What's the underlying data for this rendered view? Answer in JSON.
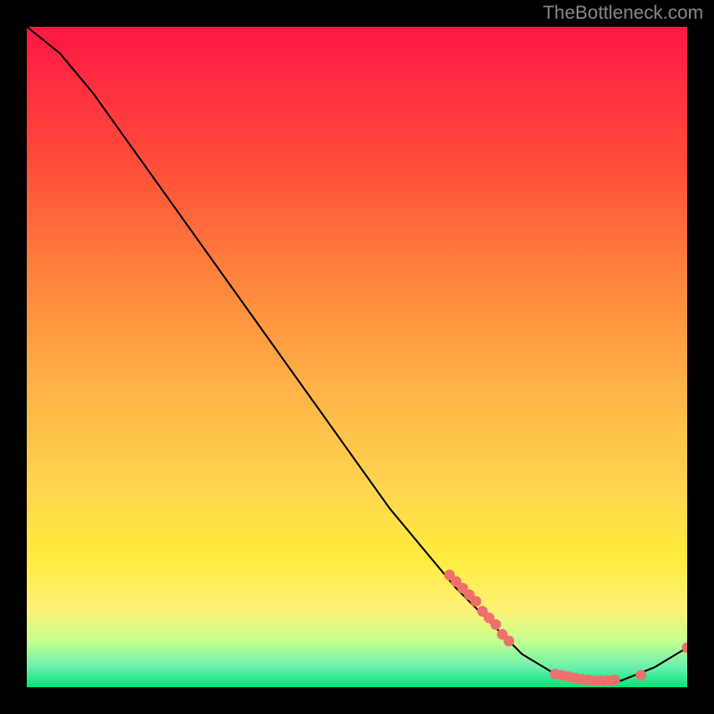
{
  "attribution": "TheBottleneck.com",
  "chart_data": {
    "type": "line",
    "title": "",
    "xlabel": "",
    "ylabel": "",
    "xlim": [
      0,
      100
    ],
    "ylim": [
      0,
      100
    ],
    "gradient_stops": [
      {
        "offset": 0,
        "color": "#ff1744"
      },
      {
        "offset": 20,
        "color": "#ff4b3a"
      },
      {
        "offset": 40,
        "color": "#ff8a3d"
      },
      {
        "offset": 55,
        "color": "#ffb347"
      },
      {
        "offset": 70,
        "color": "#ffd54f"
      },
      {
        "offset": 80,
        "color": "#ffeb3b"
      },
      {
        "offset": 88,
        "color": "#fff176"
      },
      {
        "offset": 93,
        "color": "#c6ff8e"
      },
      {
        "offset": 97,
        "color": "#69f0ae"
      },
      {
        "offset": 100,
        "color": "#00e676"
      }
    ],
    "curve": [
      {
        "x": 0,
        "y": 100
      },
      {
        "x": 5,
        "y": 96
      },
      {
        "x": 10,
        "y": 90
      },
      {
        "x": 15,
        "y": 83
      },
      {
        "x": 20,
        "y": 76
      },
      {
        "x": 25,
        "y": 69
      },
      {
        "x": 30,
        "y": 62
      },
      {
        "x": 35,
        "y": 55
      },
      {
        "x": 40,
        "y": 48
      },
      {
        "x": 45,
        "y": 41
      },
      {
        "x": 50,
        "y": 34
      },
      {
        "x": 55,
        "y": 27
      },
      {
        "x": 60,
        "y": 21
      },
      {
        "x": 65,
        "y": 15
      },
      {
        "x": 70,
        "y": 10
      },
      {
        "x": 75,
        "y": 5
      },
      {
        "x": 80,
        "y": 2
      },
      {
        "x": 85,
        "y": 1
      },
      {
        "x": 90,
        "y": 1
      },
      {
        "x": 95,
        "y": 3
      },
      {
        "x": 100,
        "y": 6
      }
    ],
    "scatter_points": [
      {
        "x": 64,
        "y": 17
      },
      {
        "x": 65,
        "y": 16
      },
      {
        "x": 66,
        "y": 15
      },
      {
        "x": 67,
        "y": 14
      },
      {
        "x": 68,
        "y": 13
      },
      {
        "x": 69,
        "y": 11.5
      },
      {
        "x": 70,
        "y": 10.5
      },
      {
        "x": 71,
        "y": 9.5
      },
      {
        "x": 72,
        "y": 8
      },
      {
        "x": 73,
        "y": 7
      },
      {
        "x": 80,
        "y": 2
      },
      {
        "x": 81,
        "y": 1.8
      },
      {
        "x": 82,
        "y": 1.6
      },
      {
        "x": 83,
        "y": 1.4
      },
      {
        "x": 84,
        "y": 1.2
      },
      {
        "x": 85,
        "y": 1.1
      },
      {
        "x": 86,
        "y": 1
      },
      {
        "x": 87,
        "y": 1
      },
      {
        "x": 88,
        "y": 1
      },
      {
        "x": 89,
        "y": 1.1
      },
      {
        "x": 93,
        "y": 1.8
      },
      {
        "x": 100,
        "y": 6
      }
    ],
    "point_color": "#ef6f6c",
    "point_radius": 6,
    "curve_color": "#000000",
    "curve_width": 2
  }
}
